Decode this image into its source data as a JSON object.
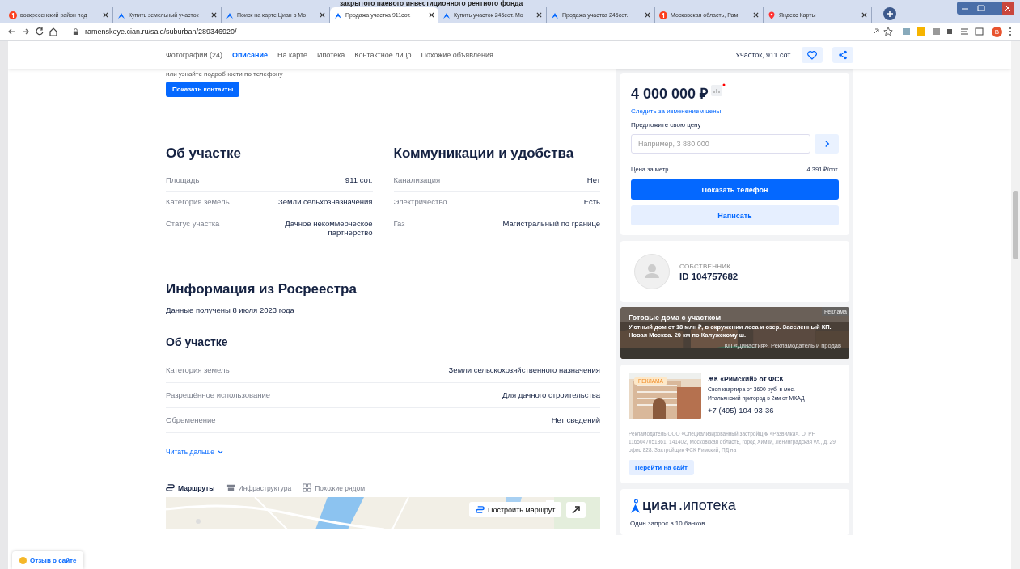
{
  "browser": {
    "overlay_caption": "закрытого паевого инвестиционного рентного фонда",
    "tabs": [
      {
        "title": "воскресенский район под",
        "kind": "yandex",
        "selected": false
      },
      {
        "title": "Купить земельный участок",
        "kind": "cian",
        "selected": false
      },
      {
        "title": "Поиск на карте Циан в Мо",
        "kind": "cian",
        "selected": false
      },
      {
        "title": "Продажа участка 911сот.",
        "kind": "cian",
        "selected": true
      },
      {
        "title": "Купить участок 245сот. Мо",
        "kind": "cian",
        "selected": false
      },
      {
        "title": "Продажа участка 245сот.",
        "kind": "cian",
        "selected": false
      },
      {
        "title": "Московская область, Рам",
        "kind": "yandex",
        "selected": false
      },
      {
        "title": "Яндекс Карты",
        "kind": "maps",
        "selected": false
      }
    ],
    "url": "ramenskoye.cian.ru/sale/suburban/289346920/",
    "profile": "В"
  },
  "nav": {
    "items": [
      {
        "label": "Фотографии (24)",
        "selected": false
      },
      {
        "label": "Описание",
        "selected": true
      },
      {
        "label": "На карте",
        "selected": false
      },
      {
        "label": "Ипотека",
        "selected": false
      },
      {
        "label": "Контактное лицо",
        "selected": false
      },
      {
        "label": "Похожие объявления",
        "selected": false
      }
    ],
    "summary": "Участок, 911 сот."
  },
  "contacts": {
    "hint": "или узнайте подробности по телефону",
    "button": "Показать контакты"
  },
  "about": {
    "title": "Об участке",
    "rows": [
      {
        "label": "Площадь",
        "value": "911 сот."
      },
      {
        "label": "Категория земель",
        "value": "Земли сельхозназначения"
      },
      {
        "label": "Статус участка",
        "value": "Дачное некоммерческое партнерство"
      }
    ]
  },
  "amenities": {
    "title": "Коммуникации и удобства",
    "rows": [
      {
        "label": "Канализация",
        "value": "Нет"
      },
      {
        "label": "Электричество",
        "value": "Есть"
      },
      {
        "label": "Газ",
        "value": "Магистральный по границе"
      }
    ]
  },
  "registry": {
    "title": "Информация из Росреестра",
    "date": "Данные получены 8 июля 2023 года",
    "subtitle": "Об участке",
    "rows": [
      {
        "label": "Категория земель",
        "value": "Земли сельскохозяйственного назначения"
      },
      {
        "label": "Разрешённое использование",
        "value": "Для дачного строительства"
      },
      {
        "label": "Обременение",
        "value": "Нет сведений"
      }
    ],
    "read_more": "Читать дальше"
  },
  "map": {
    "tabs": [
      {
        "label": "Маршруты",
        "kind": "routes",
        "selected": true
      },
      {
        "label": "Инфраструктура",
        "kind": "infra",
        "selected": false
      },
      {
        "label": "Похожие рядом",
        "kind": "similar",
        "selected": false
      }
    ],
    "route_button": "Построить маршрут"
  },
  "price_card": {
    "price": "4 000 000 ₽",
    "follow_link": "Следить за изменением цены",
    "offer_label": "Предложите свою цену",
    "offer_placeholder": "Например, 3 880 000",
    "per_meter_label": "Цена за метр",
    "per_meter_value": "4 391 ₽/сот.",
    "phone_button": "Показать телефон",
    "write_button": "Написать"
  },
  "owner": {
    "role": "СОБСТВЕННИК",
    "id": "ID 104757682"
  },
  "banner": {
    "badge": "Реклама",
    "title": "Готовые дома с участком",
    "text": "Уютный дом от 18 млн ₽, в окружении леса и озер. Заселенный КП. Новая Москва. 20 км по Калужскому ш.",
    "footer": "КП «Династия». Рекламодатель и продав"
  },
  "ad": {
    "badge": "РЕКЛАМА",
    "title": "ЖК «Римский» от ФСК",
    "lines": [
      "Своя квартира от 3600 руб. в мес.",
      "Итальянский пригород в 2км от МКАД"
    ],
    "phone": "+7 (495) 104-93-36",
    "disclaimer": "Рекламодатель ООО «Специализированный застройщик «Развилка», ОГРН 1165047051861. 141402, Московская область, город Химки, Ленинградская ул., д. 29, офис 828. Застройщик ФСК Римский, ПД на",
    "button": "Перейти на сайт"
  },
  "ipoteka": {
    "logo_main": "циан",
    "logo_suffix": ".ипотека",
    "text": "Один запрос в 10 банков"
  },
  "feedback": "Отзыв о сайте"
}
